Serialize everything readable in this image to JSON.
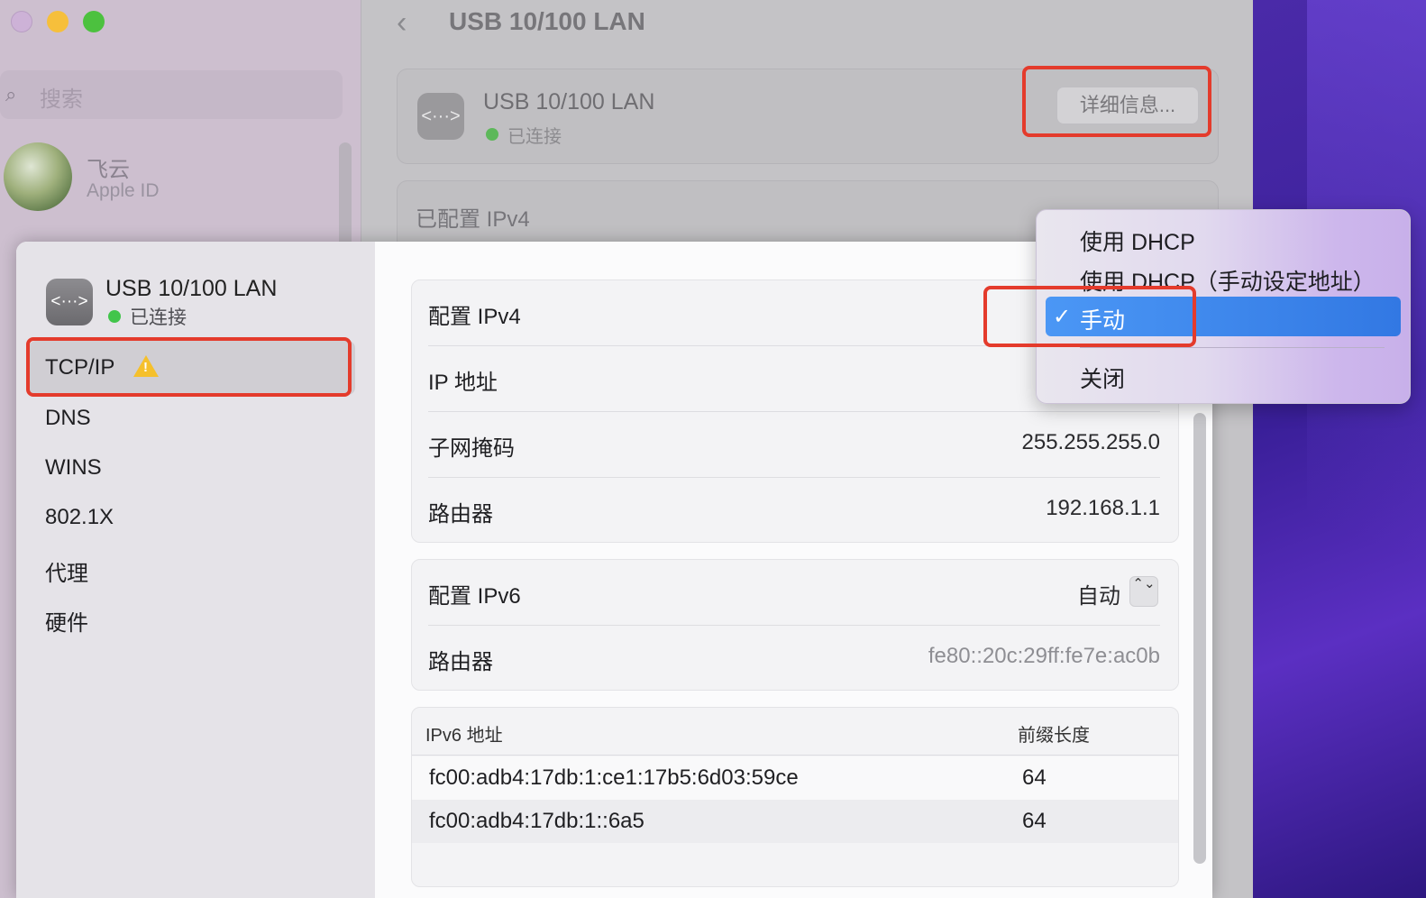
{
  "background_window": {
    "search_placeholder": "搜索",
    "user_name": "飞云",
    "user_subtitle": "Apple ID",
    "page_title": "USB 10/100 LAN",
    "card_name": "USB 10/100 LAN",
    "card_status": "已连接",
    "details_button": "详细信息...",
    "configured_label": "已配置 IPv4"
  },
  "sheet": {
    "sidebar": {
      "interface_name": "USB 10/100 LAN",
      "interface_status": "已连接",
      "items": [
        {
          "label": "TCP/IP",
          "selected": true,
          "warning": true
        },
        {
          "label": "DNS"
        },
        {
          "label": "WINS"
        },
        {
          "label": "802.1X"
        },
        {
          "label": "代理"
        },
        {
          "label": "硬件"
        }
      ]
    },
    "ipv4": {
      "config_label": "配置 IPv4",
      "ip_label": "IP 地址",
      "subnet_label": "子网掩码",
      "subnet_value": "255.255.255.0",
      "router_label": "路由器",
      "router_value": "192.168.1.1"
    },
    "ipv6": {
      "config_label": "配置 IPv6",
      "config_value": "自动",
      "router_label": "路由器",
      "router_value": "fe80::20c:29ff:fe7e:ac0b"
    },
    "ipv6_table": {
      "headers": [
        "IPv6 地址",
        "前缀长度"
      ],
      "rows": [
        {
          "address": "fc00:adb4:17db:1:ce1:17b5:6d03:59ce",
          "prefix": "64"
        },
        {
          "address": "fc00:adb4:17db:1::6a5",
          "prefix": "64"
        }
      ]
    }
  },
  "popup_menu": {
    "items": [
      "使用 DHCP",
      "使用 DHCP（手动设定地址）",
      "手动",
      "关闭"
    ],
    "selected": "手动",
    "check_glyph": "✓"
  },
  "icons": {
    "network": "<···>",
    "back": "‹",
    "search": "⌕",
    "warning_mark": "!",
    "stepper": "⌃⌄"
  },
  "colors": {
    "highlight_box": "#e43b2c",
    "menu_selection": "#3f87ee",
    "connected_dot": "#42c54b",
    "warning": "#f5c02c"
  }
}
